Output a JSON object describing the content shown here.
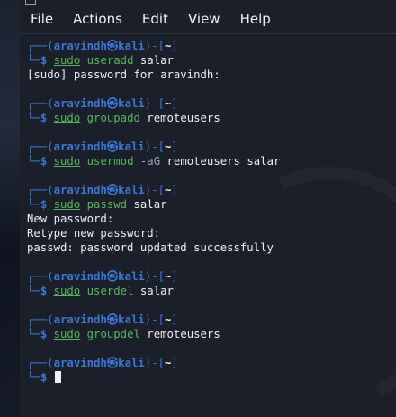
{
  "menu": [
    "File",
    "Actions",
    "Edit",
    "View",
    "Help"
  ],
  "prompt": {
    "user": "aravindh",
    "at": "㉿",
    "host": "kali",
    "cwd": "~",
    "frame_top_left": "┌──(",
    "frame_mid": ")-[",
    "frame_end": "]",
    "frame_bottom": "└─",
    "dollar": "$"
  },
  "blocks": [
    {
      "sudo": "sudo",
      "command": "useradd",
      "flags": "",
      "args": "salar",
      "output": [
        "[sudo] password for aravindh:"
      ]
    },
    {
      "sudo": "sudo",
      "command": "groupadd",
      "flags": "",
      "args": "remoteusers",
      "output": []
    },
    {
      "sudo": "sudo",
      "command": "usermod",
      "flags": "-aG",
      "args": "remoteusers salar",
      "output": []
    },
    {
      "sudo": "sudo",
      "command": "passwd",
      "flags": "",
      "args": "salar",
      "output": [
        "New password:",
        "Retype new password:",
        "passwd: password updated successfully"
      ]
    },
    {
      "sudo": "sudo",
      "command": "userdel",
      "flags": "",
      "args": "salar",
      "output": []
    },
    {
      "sudo": "sudo",
      "command": "groupdel",
      "flags": "",
      "args": "remoteusers",
      "output": []
    }
  ]
}
